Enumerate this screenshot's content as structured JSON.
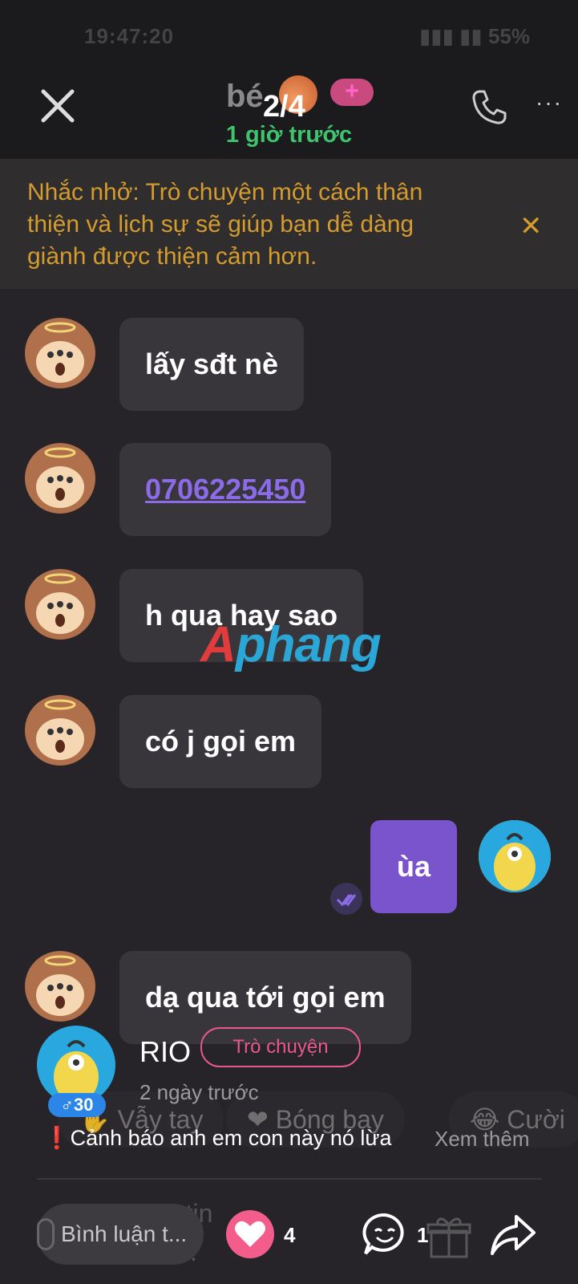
{
  "status_bar": {
    "time": "19:47:20",
    "battery": "55%"
  },
  "header": {
    "name": "bé",
    "counter": "2/4",
    "last_seen": "1 giờ trước"
  },
  "reminder": {
    "text": "Nhắc nhở: Trò chuyện một cách thân thiện và lịch sự sẽ giúp bạn dễ dàng giành được thiện cảm hơn."
  },
  "messages": [
    {
      "from": "other",
      "text": "lấy sđt nè"
    },
    {
      "from": "other",
      "text": "0706225450"
    },
    {
      "from": "other",
      "text": "h qua hay sao"
    },
    {
      "from": "other",
      "text": "có j gọi em"
    },
    {
      "from": "me",
      "text": "ùa"
    },
    {
      "from": "other",
      "text": "dạ qua tới gọi em"
    }
  ],
  "watermark": {
    "prefix": "A",
    "rest": "phang"
  },
  "comment": {
    "user": "RIO",
    "chat_button": "Trò chuyện",
    "time": "2 ngày trước",
    "badge": "♂30",
    "text": "❗Cảnh báo anh em con này nó lừa",
    "more": "Xem thêm"
  },
  "quick_replies": [
    "Vẫy tay",
    "Bóng bay",
    "Cười"
  ],
  "compose_placeholder": "Soạn tin nhắn...",
  "bottom_bar": {
    "comment_placeholder": "Bình luận t...",
    "likes": "4",
    "comments": "1"
  }
}
